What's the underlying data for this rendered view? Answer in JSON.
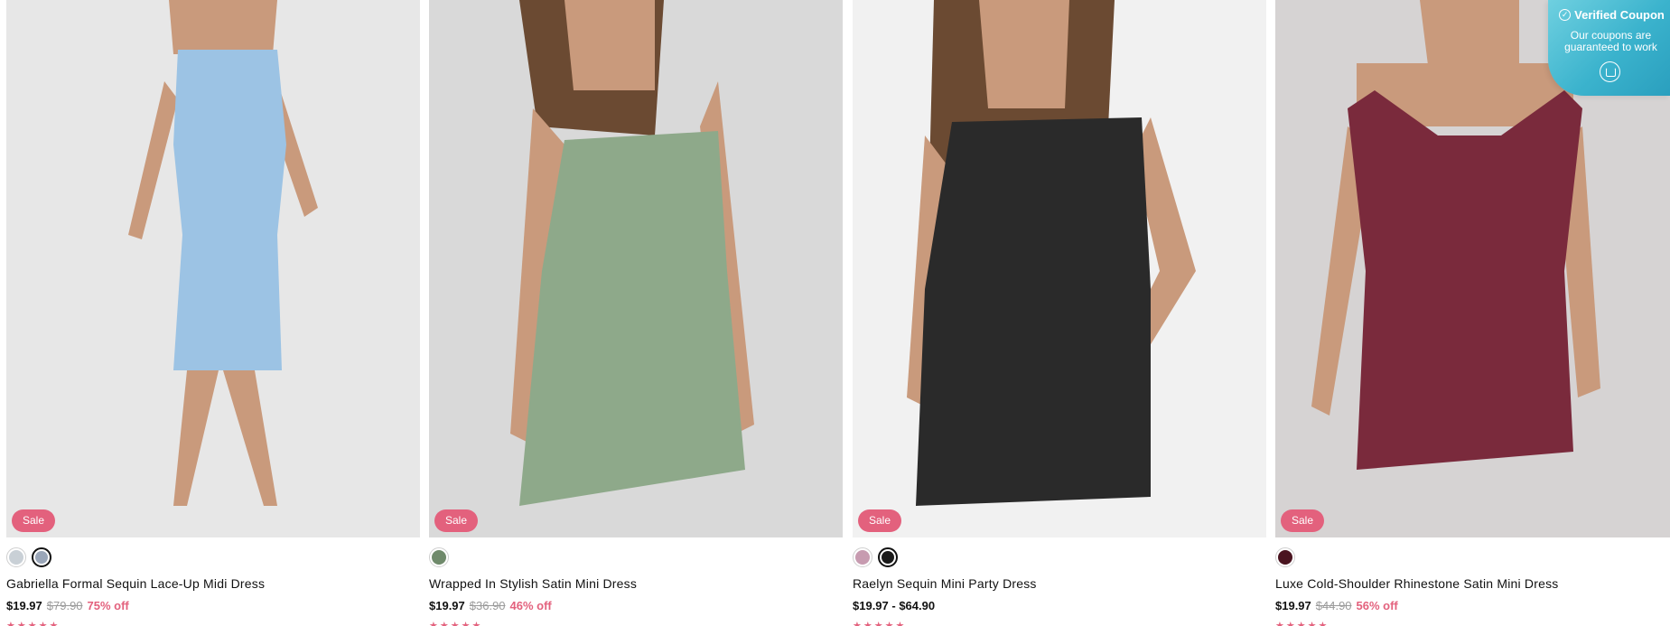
{
  "products": [
    {
      "name": "Gabriella Formal Sequin Lace-Up Midi Dress",
      "price": "$19.97",
      "original_price": "$79.90",
      "discount": "75% off",
      "badge": "Sale",
      "stars": "★★★★★",
      "swatches": [
        "#c9d0d6",
        "#9aa6b8"
      ],
      "selected_swatch": 1,
      "bg": "#e7e7e7",
      "dress_color": "#9cc3e4"
    },
    {
      "name": "Wrapped In Stylish Satin Mini Dress",
      "price": "$19.97",
      "original_price": "$36.90",
      "discount": "46% off",
      "badge": "Sale",
      "stars": "★★★★★",
      "swatches": [
        "#6f8a6b"
      ],
      "selected_swatch": -1,
      "bg": "#d9d9d9",
      "dress_color": "#8ea98a"
    },
    {
      "name": "Raelyn Sequin Mini Party Dress",
      "price": "$19.97 - $64.90",
      "original_price": "",
      "discount": "",
      "badge": "Sale",
      "stars": "★★★★★",
      "swatches": [
        "#c79bb0",
        "#1a1a1a"
      ],
      "selected_swatch": 1,
      "bg": "#f1f1f1",
      "dress_color": "#2a2a2a"
    },
    {
      "name": "Luxe Cold-Shoulder Rhinestone Satin Mini Dress",
      "price": "$19.97",
      "original_price": "$44.90",
      "discount": "56% off",
      "badge": "Sale",
      "stars": "★★★★★",
      "swatches": [
        "#4a1420"
      ],
      "selected_swatch": -1,
      "bg": "#d6d3d3",
      "dress_color": "#7a2a3c"
    }
  ],
  "coupon": {
    "title": "Verified Coupon",
    "subtitle": "Our coupons are guaranteed to work"
  }
}
